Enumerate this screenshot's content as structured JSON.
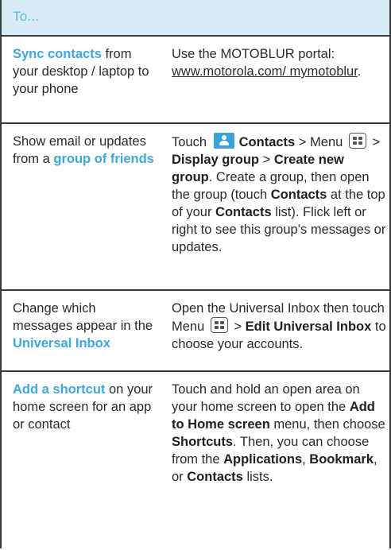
{
  "header": {
    "title": "To..."
  },
  "rows": [
    {
      "left": {
        "accent": "Sync contacts",
        "rest": " from your desktop / laptop to your phone"
      },
      "right": {
        "text1": "Use the MOTOBLUR portal: ",
        "link": "www.motorola.com/ mymotoblur",
        "text2": "."
      }
    },
    {
      "left": {
        "pre": "Show email or updates from a ",
        "accent": "group of friends"
      },
      "right": {
        "t1": "Touch ",
        "contacts": "Contacts",
        "t2": " > Menu ",
        "t3": " > ",
        "display_group": "Display group",
        "t4": " > ",
        "create_new_group": "Create new group",
        "t5": ". Create a group, then open the group (touch ",
        "contacts2": "Contacts",
        "t6": " at the top of your ",
        "contacts3": "Contacts",
        "t7": " list). Flick left or right to see this group’s messages or updates."
      }
    },
    {
      "left": {
        "pre": "Change which messages appear in the ",
        "accent": "Universal Inbox"
      },
      "right": {
        "t1": "Open the Universal Inbox then touch Menu ",
        "t2": " > ",
        "edit": "Edit Universal Inbox",
        "t3": " to choose your accounts."
      }
    },
    {
      "left": {
        "accent": "Add a shortcut",
        "rest": " on your home screen for an app or contact"
      },
      "right": {
        "t1": "Touch and hold an open area on your home screen to open the ",
        "add_home": "Add to Home screen",
        "t2": " menu, then choose ",
        "shortcuts": "Shortcuts",
        "t3": ". Then, you can choose from the ",
        "applications": "Applications",
        "t4": ", ",
        "bookmark": "Bookmark",
        "t5": ", or ",
        "contacts": "Contacts",
        "t6": " lists."
      }
    }
  ],
  "icons": {
    "contacts": "contacts-app-icon",
    "menu": "menu-key-icon"
  },
  "colors": {
    "accent": "#3fa7db",
    "header_bg": "#d7ecf6",
    "header_text": "#5bb7e0",
    "rule": "#3a3a3a"
  }
}
